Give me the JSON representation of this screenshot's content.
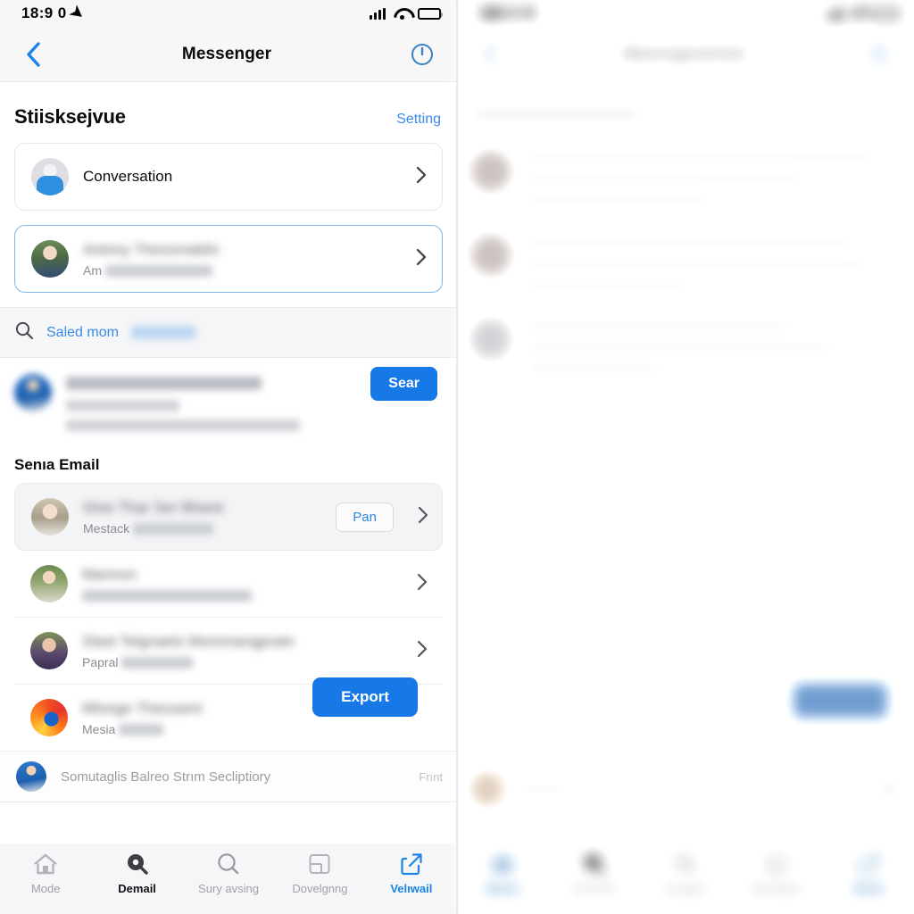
{
  "left": {
    "status": {
      "time": "18:9 0",
      "location_arrow": "➤",
      "signal_icon": "signal-bars-icon",
      "wifi_icon": "wifi-icon",
      "battery_icon": "battery-icon"
    },
    "nav": {
      "back_icon": "chevron-left-icon",
      "title": "Messenger",
      "action_icon": "power-clock-icon"
    },
    "section": {
      "title": "Stiisksejvue",
      "link": "Setting"
    },
    "cards": [
      {
        "title": "Conversation",
        "subtitle": "",
        "avatar": "generic-avatar",
        "chevron": "chevron-right-icon",
        "selected": false
      },
      {
        "title": "",
        "subtitle": "Am",
        "avatar": "person-avatar",
        "chevron": "chevron-right-icon",
        "selected": true
      }
    ],
    "search": {
      "icon": "search-icon",
      "text": "Saled mom"
    },
    "result": {
      "button_label": "Sear"
    },
    "list": {
      "heading": "Senıa Email",
      "rows": [
        {
          "title": "",
          "subtitle": "Mestack",
          "avatar": "person-avatar",
          "action_label": "Pan",
          "chevron": "chevron-right-icon",
          "highlighted": true
        },
        {
          "title": "",
          "subtitle": "",
          "avatar": "person-avatar",
          "action_label": "",
          "chevron": "chevron-right-icon",
          "highlighted": false
        },
        {
          "title": "",
          "subtitle": "Papral",
          "avatar": "person-avatar",
          "action_label": "",
          "chevron": "chevron-right-icon",
          "highlighted": false
        },
        {
          "title": "",
          "subtitle": "Mesia",
          "avatar": "firefox-icon",
          "action_label": "",
          "chevron": "",
          "highlighted": false
        }
      ],
      "export_label": "Export"
    },
    "footer": {
      "text": "Somutaglis Balreo Strım Secliptiory",
      "right_text": "Frınt",
      "avatar": "person-avatar"
    },
    "tabs": [
      {
        "label": "Mode",
        "icon": "home-icon",
        "state": "inactive"
      },
      {
        "label": "Demail",
        "icon": "filled-search-icon",
        "state": "active-dark"
      },
      {
        "label": "Sury avsing",
        "icon": "search-icon",
        "state": "inactive"
      },
      {
        "label": "Dovelgnng",
        "icon": "window-icon",
        "state": "inactive"
      },
      {
        "label": "Velıwail",
        "icon": "share-export-icon",
        "state": "active-blue"
      }
    ]
  },
  "right": {
    "status": {
      "time": "1฿0.0"
    },
    "nav": {
      "back_icon": "chevron-left-icon",
      "title": "",
      "action_icon": "share-export-icon"
    },
    "tabs": [
      {
        "label": "Mome",
        "icon": "home-icon",
        "state": "active-blue"
      },
      {
        "label": "",
        "icon": "filled-search-icon",
        "state": "inactive"
      },
      {
        "label": "",
        "icon": "search-icon",
        "state": "inactive"
      },
      {
        "label": "",
        "icon": "window-icon",
        "state": "inactive"
      },
      {
        "label": "Dood",
        "icon": "share-export-icon",
        "state": "active-blue"
      }
    ]
  },
  "colors": {
    "accent_blue": "#1778e8",
    "link_blue": "#3b8bea",
    "tab_active_blue": "#1b84e4",
    "text_primary": "#0b0b0c",
    "text_muted": "#8b8d93",
    "bar_background": "#f5f6f7"
  }
}
